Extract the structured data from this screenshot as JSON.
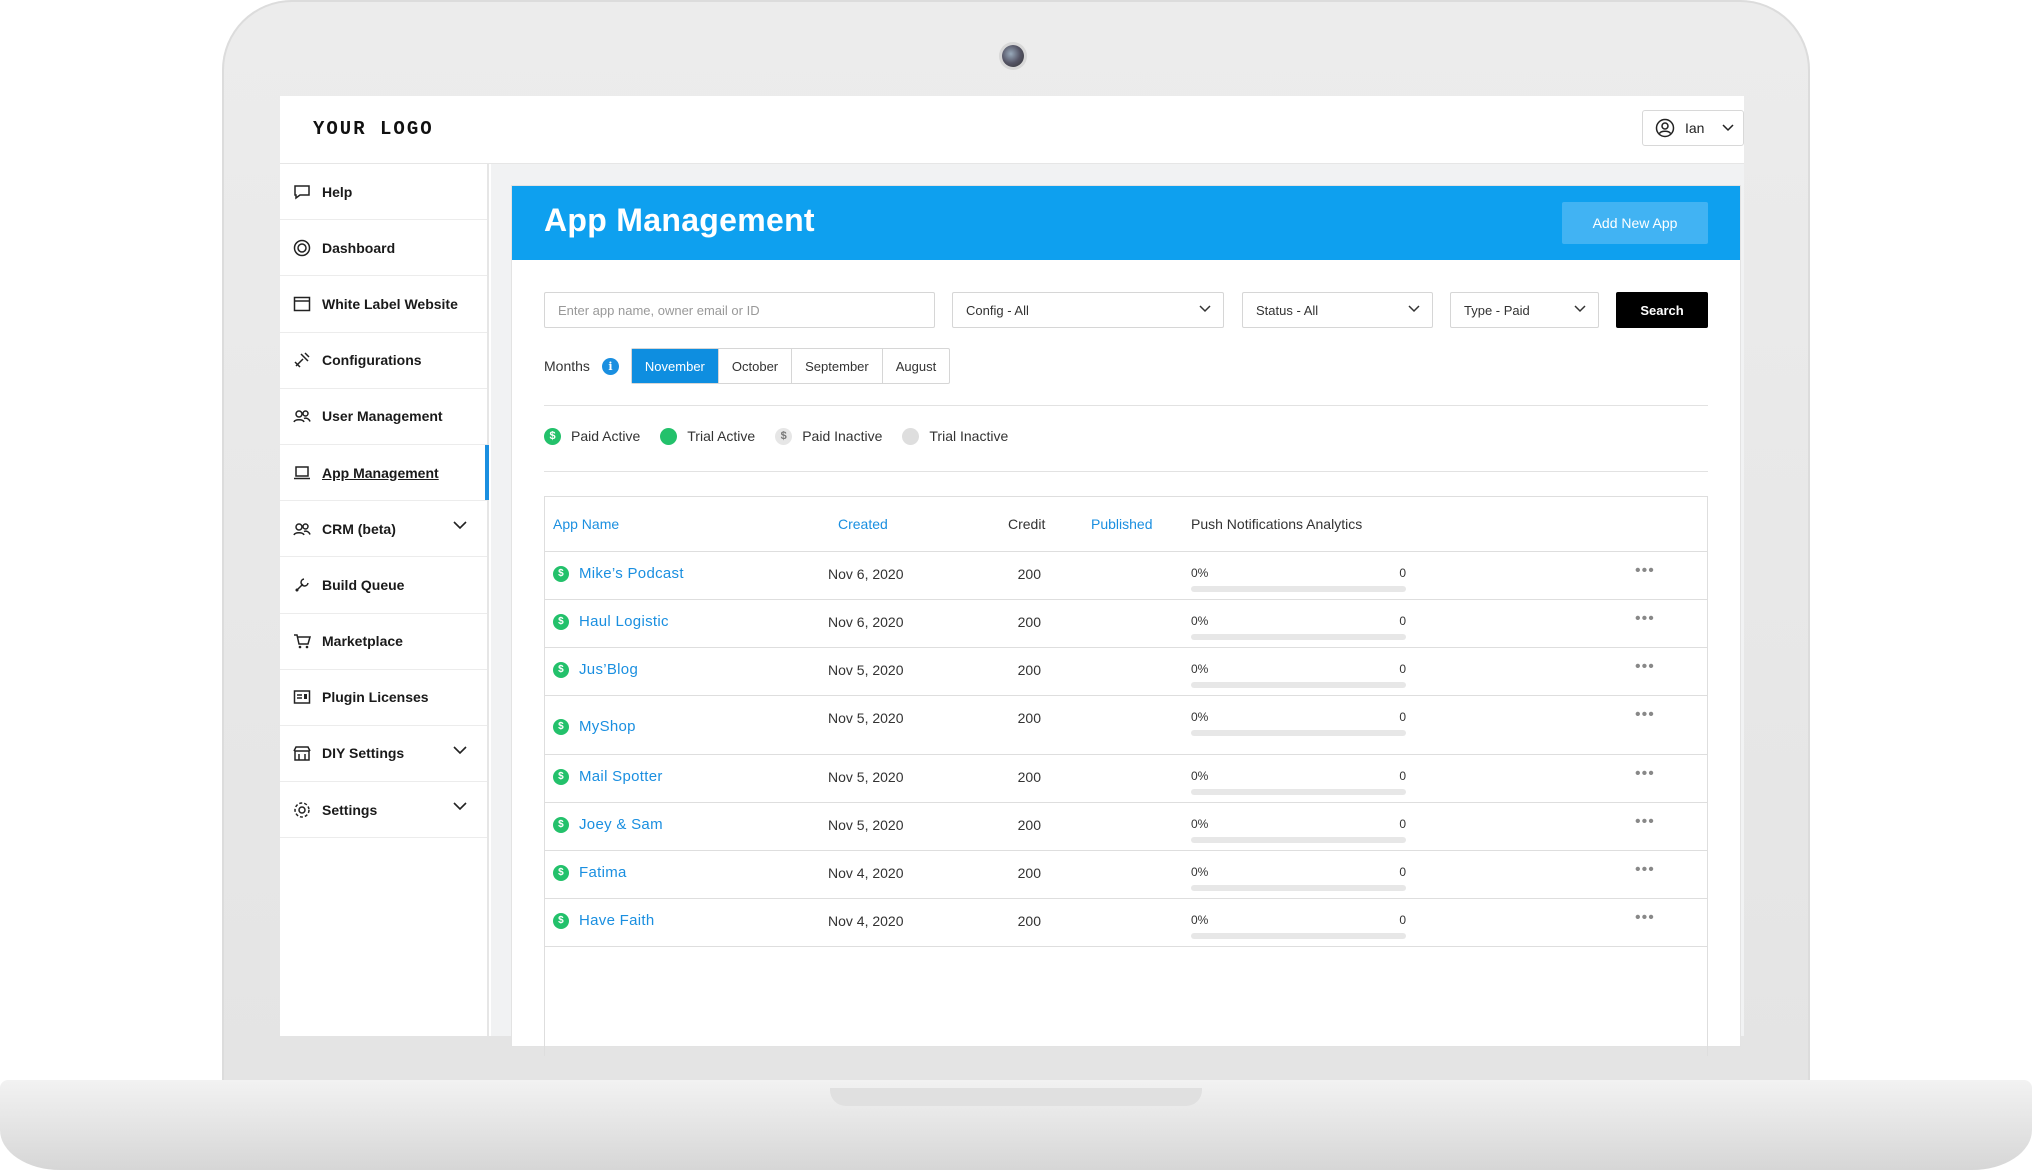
{
  "brand": {
    "logo": "YOUR LOGO"
  },
  "user": {
    "name": "Ian"
  },
  "sidebar": {
    "items": [
      {
        "label": "Help",
        "icon": "chat-bubble-icon"
      },
      {
        "label": "Dashboard",
        "icon": "dashboard-icon"
      },
      {
        "label": "White Label Website",
        "icon": "browser-window-icon"
      },
      {
        "label": "Configurations",
        "icon": "tools-icon"
      },
      {
        "label": "User Management",
        "icon": "users-icon"
      },
      {
        "label": "App Management",
        "icon": "laptop-icon",
        "active": true
      },
      {
        "label": "CRM (beta)",
        "icon": "users-icon",
        "expandable": true
      },
      {
        "label": "Build Queue",
        "icon": "wrench-icon"
      },
      {
        "label": "Marketplace",
        "icon": "cart-icon"
      },
      {
        "label": "Plugin Licenses",
        "icon": "license-icon"
      },
      {
        "label": "DIY Settings",
        "icon": "store-icon",
        "expandable": true
      },
      {
        "label": "Settings",
        "icon": "gear-icon",
        "expandable": true
      }
    ]
  },
  "page": {
    "title": "App Management",
    "add_button": "Add New App"
  },
  "filters": {
    "search_placeholder": "Enter app name, owner email or ID",
    "search_value": "",
    "config": "Config - All",
    "status": "Status - All",
    "type": "Type - Paid",
    "search_button": "Search"
  },
  "months": {
    "label": "Months",
    "options": [
      "November",
      "October",
      "September",
      "August"
    ],
    "selected": "November"
  },
  "legend": [
    {
      "label": "Paid Active",
      "symbol": "$"
    },
    {
      "label": "Trial Active",
      "symbol": ""
    },
    {
      "label": "Paid Inactive",
      "symbol": "$"
    },
    {
      "label": "Trial Inactive",
      "symbol": ""
    }
  ],
  "colors": {
    "header_blue": "#0ea0ef",
    "link_blue": "#1a8fe0",
    "active_green": "#23c16b"
  },
  "table": {
    "columns": {
      "app_name": "App Name",
      "created": "Created",
      "credit": "Credit",
      "published": "Published",
      "push": "Push Notifications Analytics"
    },
    "rows": [
      {
        "name": "Mike’s Podcast",
        "created": "Nov 6, 2020",
        "credit": "200",
        "push_pct": "0%",
        "push_count": "0",
        "push_fraction": 0
      },
      {
        "name": "Haul Logistic",
        "created": "Nov 6, 2020",
        "credit": "200",
        "push_pct": "0%",
        "push_count": "0",
        "push_fraction": 0
      },
      {
        "name": "Jus’Blog",
        "created": "Nov 5, 2020",
        "credit": "200",
        "push_pct": "0%",
        "push_count": "0",
        "push_fraction": 0
      },
      {
        "name": "MyShop",
        "created": "Nov 5, 2020",
        "credit": "200",
        "push_pct": "0%",
        "push_count": "0",
        "push_fraction": 0
      },
      {
        "name": "Mail Spotter",
        "created": "Nov 5, 2020",
        "credit": "200",
        "push_pct": "0%",
        "push_count": "0",
        "push_fraction": 0
      },
      {
        "name": "Joey & Sam",
        "created": "Nov 5, 2020",
        "credit": "200",
        "push_pct": "0%",
        "push_count": "0",
        "push_fraction": 0
      },
      {
        "name": "Fatima",
        "created": "Nov 4, 2020",
        "credit": "200",
        "push_pct": "0%",
        "push_count": "0",
        "push_fraction": 0
      },
      {
        "name": "Have Faith",
        "created": "Nov 4, 2020",
        "credit": "200",
        "push_pct": "0%",
        "push_count": "0",
        "push_fraction": 0
      }
    ]
  }
}
